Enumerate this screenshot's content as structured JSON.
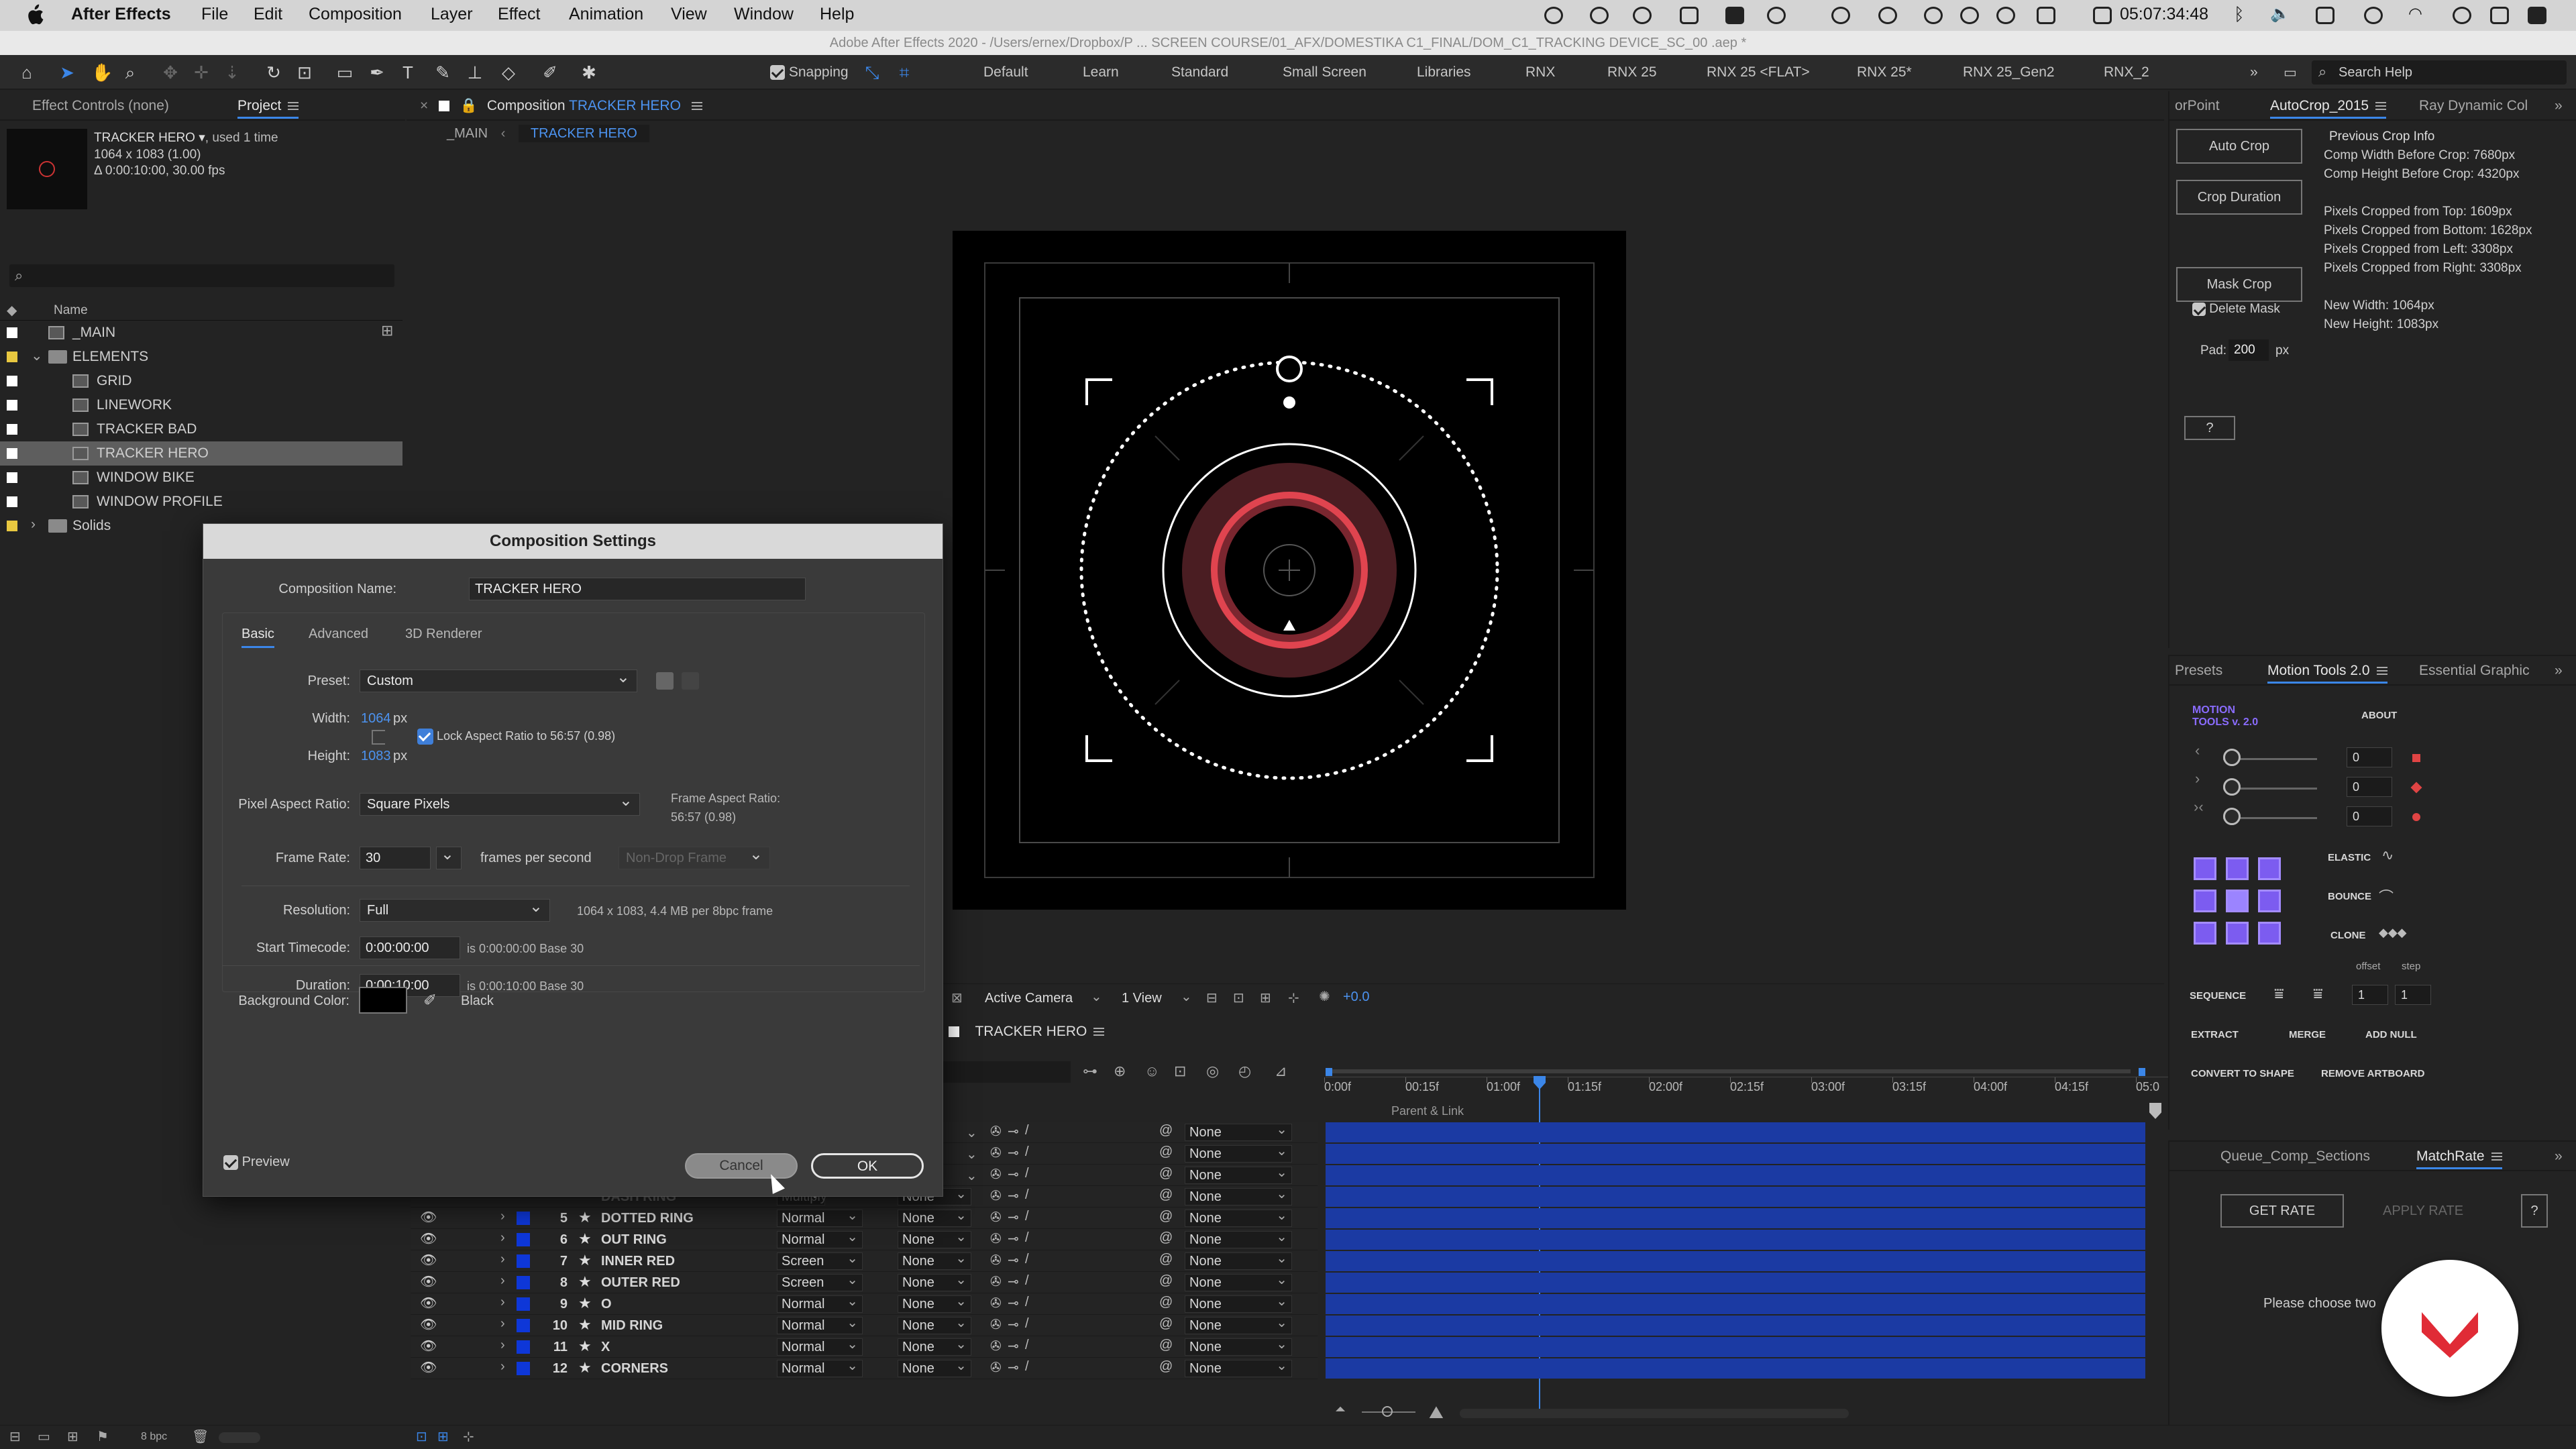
{
  "menubar": {
    "app_name": "After Effects",
    "items": [
      "File",
      "Edit",
      "Composition",
      "Layer",
      "Effect",
      "Animation",
      "View",
      "Window",
      "Help"
    ],
    "clock": "05:07:34:48"
  },
  "window_title": "Adobe After Effects 2020 - /Users/ernex/Dropbox/P ... SCREEN COURSE/01_AFX/DOMESTIKA C1_FINAL/DOM_C1_TRACKING DEVICE_SC_00 .aep *",
  "toolbar": {
    "snapping_label": "Snapping",
    "workspaces": [
      "Default",
      "Learn",
      "Standard",
      "Small Screen",
      "Libraries",
      "RNX",
      "RNX 25",
      "RNX 25 <FLAT>",
      "RNX 25*",
      "RNX 25_Gen2",
      "RNX_2"
    ],
    "search_placeholder": "Search Help"
  },
  "project_panel": {
    "tabs": [
      "Effect Controls (none)",
      "Project"
    ],
    "selected_name": "TRACKER HERO ▾",
    "used": ", used 1 time",
    "dims": "1064 x 1083 (1.00)",
    "duration": "Δ 0:00:10:00, 30.00 fps",
    "search_placeholder": "⌕",
    "column_name": "Name",
    "items": [
      {
        "name": "_MAIN",
        "type": "comp",
        "indent": 0,
        "label": "#ffffff"
      },
      {
        "name": "ELEMENTS",
        "type": "folder",
        "indent": 0,
        "label": "#e8c840"
      },
      {
        "name": "GRID",
        "type": "comp",
        "indent": 1,
        "label": "#ffffff"
      },
      {
        "name": "LINEWORK",
        "type": "comp",
        "indent": 1,
        "label": "#ffffff"
      },
      {
        "name": "TRACKER BAD",
        "type": "comp",
        "indent": 1,
        "label": "#ffffff"
      },
      {
        "name": "TRACKER HERO",
        "type": "comp",
        "indent": 1,
        "label": "#ffffff",
        "selected": true
      },
      {
        "name": "WINDOW BIKE",
        "type": "comp",
        "indent": 1,
        "label": "#ffffff"
      },
      {
        "name": "WINDOW PROFILE",
        "type": "comp",
        "indent": 1,
        "label": "#ffffff"
      },
      {
        "name": "Solids",
        "type": "folder",
        "indent": 0,
        "label": "#e8c840"
      }
    ],
    "bpc": "8 bpc"
  },
  "composition_panel": {
    "tab_prefix": "Composition",
    "tab_name": "TRACKER HERO",
    "breadcrumbs": [
      "_MAIN",
      "TRACKER HERO"
    ],
    "camera": "Active Camera",
    "view": "1 View",
    "exposure": "+0.0"
  },
  "timeline": {
    "tab": "TRACKER HERO",
    "parent_header": "Parent & Link",
    "ruler": [
      "0:00f",
      "00:15f",
      "01:00f",
      "01:15f",
      "02:00f",
      "02:15f",
      "03:00f",
      "03:15f",
      "04:00f",
      "04:15f",
      "05:0"
    ],
    "layers": [
      {
        "num": "5",
        "name": "DOTTED RING",
        "mode": "Normal",
        "parent": "None"
      },
      {
        "num": "6",
        "name": "OUT RING",
        "mode": "Normal",
        "parent": "None"
      },
      {
        "num": "7",
        "name": "INNER RED",
        "mode": "Screen",
        "parent": "None"
      },
      {
        "num": "8",
        "name": "OUTER RED",
        "mode": "Screen",
        "parent": "None"
      },
      {
        "num": "9",
        "name": "O",
        "mode": "Normal",
        "parent": "None"
      },
      {
        "num": "10",
        "name": "MID RING",
        "mode": "Normal",
        "parent": "None"
      },
      {
        "num": "11",
        "name": "X",
        "mode": "Normal",
        "parent": "None"
      },
      {
        "num": "12",
        "name": "CORNERS",
        "mode": "Normal",
        "parent": "None"
      }
    ],
    "hidden_parent_values": [
      "None",
      "None",
      "None",
      "None"
    ],
    "partial_layer_name": "DASH RING",
    "partial_layer_mode": "Multiply",
    "partial_layer_parent": "None"
  },
  "dialog": {
    "title": "Composition Settings",
    "comp_name_label": "Composition Name:",
    "comp_name": "TRACKER HERO",
    "tabs": [
      "Basic",
      "Advanced",
      "3D Renderer"
    ],
    "preset_label": "Preset:",
    "preset": "Custom",
    "width_label": "Width:",
    "width": "1064",
    "height_label": "Height:",
    "height": "1083",
    "px": "px",
    "lock_label": "Lock Aspect Ratio to 56:57 (0.98)",
    "par_label": "Pixel Aspect Ratio:",
    "par": "Square Pixels",
    "far_label": "Frame Aspect Ratio:",
    "far_value": "56:57 (0.98)",
    "fps_label": "Frame Rate:",
    "fps": "30",
    "fps_unit": "frames per second",
    "drop_frame": "Non-Drop Frame",
    "resolution_label": "Resolution:",
    "resolution": "Full",
    "resolution_info": "1064 x 1083, 4.4 MB per 8bpc frame",
    "start_label": "Start Timecode:",
    "start": "0:00:00:00",
    "start_info": "is 0:00:00:00  Base 30",
    "duration_label": "Duration:",
    "duration": "0:00:10:00",
    "duration_info": "is 0:00:10:00  Base 30",
    "bg_label": "Background Color:",
    "bg_name": "Black",
    "preview_label": "Preview",
    "cancel": "Cancel",
    "ok": "OK"
  },
  "autocrop_panel": {
    "tabs": [
      "orPoint",
      "AutoCrop_2015",
      "Ray Dynamic Col"
    ],
    "buttons": [
      "Auto Crop",
      "Crop Duration",
      "Mask Crop"
    ],
    "delete_mask": "Delete Mask",
    "pad_label": "Pad:",
    "pad_value": "200",
    "pad_unit": "px",
    "help": "?",
    "info_title": "Previous Crop Info",
    "info_lines": [
      "Comp Width Before Crop: 7680px",
      "Comp Height Before Crop: 4320px",
      "",
      "Pixels Cropped from Top: 1609px",
      "Pixels Cropped from Bottom: 1628px",
      "Pixels Cropped from Left: 3308px",
      "Pixels Cropped from Right: 3308px",
      "",
      "New Width: 1064px",
      "New Height: 1083px"
    ]
  },
  "motion_tools": {
    "tabs": [
      "Presets",
      "Motion Tools 2.0",
      "Essential Graphic"
    ],
    "logo": "MOTION TOOLS v. 2.0",
    "about": "ABOUT",
    "slider_values": [
      "0",
      "0",
      "0"
    ],
    "elastic": "ELASTIC",
    "bounce": "BOUNCE",
    "clone": "CLONE",
    "offset": "offset",
    "step": "step",
    "sequence": "SEQUENCE",
    "seq_values": [
      "1",
      "1"
    ],
    "extract": "EXTRACT",
    "merge": "MERGE",
    "add_null": "ADD NULL",
    "convert": "CONVERT TO SHAPE",
    "remove_artboard": "REMOVE ARTBOARD"
  },
  "matchrate": {
    "tabs": [
      "Queue_Comp_Sections",
      "MatchRate"
    ],
    "get_rate": "GET RATE",
    "apply_rate": "APPLY RATE",
    "help": "?",
    "message": "Please choose two"
  },
  "colors": {
    "accent_blue": "#3b86e8",
    "layer_bar": "#1b3aa3",
    "tracker_red": "#e0444f",
    "motion_purple": "#7c5cf0",
    "domestika_red": "#e02b36"
  }
}
